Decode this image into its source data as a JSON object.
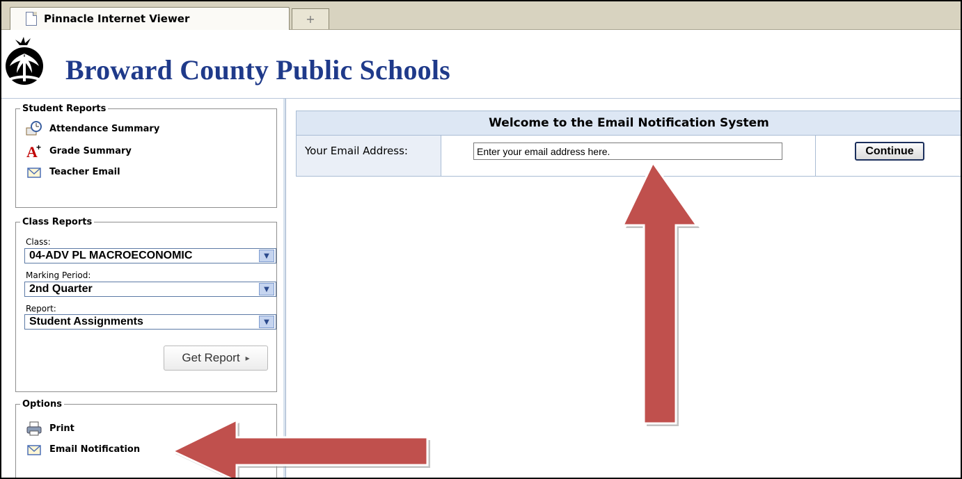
{
  "browser": {
    "tab_title": "Pinnacle Internet Viewer",
    "new_tab_symbol": "+"
  },
  "header": {
    "title": "Broward County Public Schools",
    "logo_icon": "apple-palm-logo-icon"
  },
  "sidebar": {
    "student_reports": {
      "legend": "Student Reports",
      "items": [
        {
          "label": "Attendance Summary",
          "icon": "attendance-icon"
        },
        {
          "label": "Grade Summary",
          "icon": "grade-icon"
        },
        {
          "label": "Teacher Email",
          "icon": "envelope-icon"
        }
      ]
    },
    "class_reports": {
      "legend": "Class Reports",
      "class_label": "Class:",
      "class_value": "04-ADV PL MACROECONOMIC",
      "period_label": "Marking Period:",
      "period_value": "2nd Quarter",
      "report_label": "Report:",
      "report_value": "Student Assignments",
      "get_report_label": "Get Report",
      "get_report_arrow": "▸"
    },
    "options": {
      "legend": "Options",
      "items": [
        {
          "label": "Print",
          "icon": "printer-icon"
        },
        {
          "label": "Email Notification",
          "icon": "envelope-icon"
        }
      ]
    }
  },
  "main": {
    "welcome_title": "Welcome to the Email Notification System",
    "email_label": "Your Email Address:",
    "email_value": "Enter your email address here.",
    "continue_label": "Continue"
  },
  "colors": {
    "title_blue": "#1f3a8a",
    "header_bar": "#dde7f4",
    "annotation_arrow": "#c0504d"
  }
}
